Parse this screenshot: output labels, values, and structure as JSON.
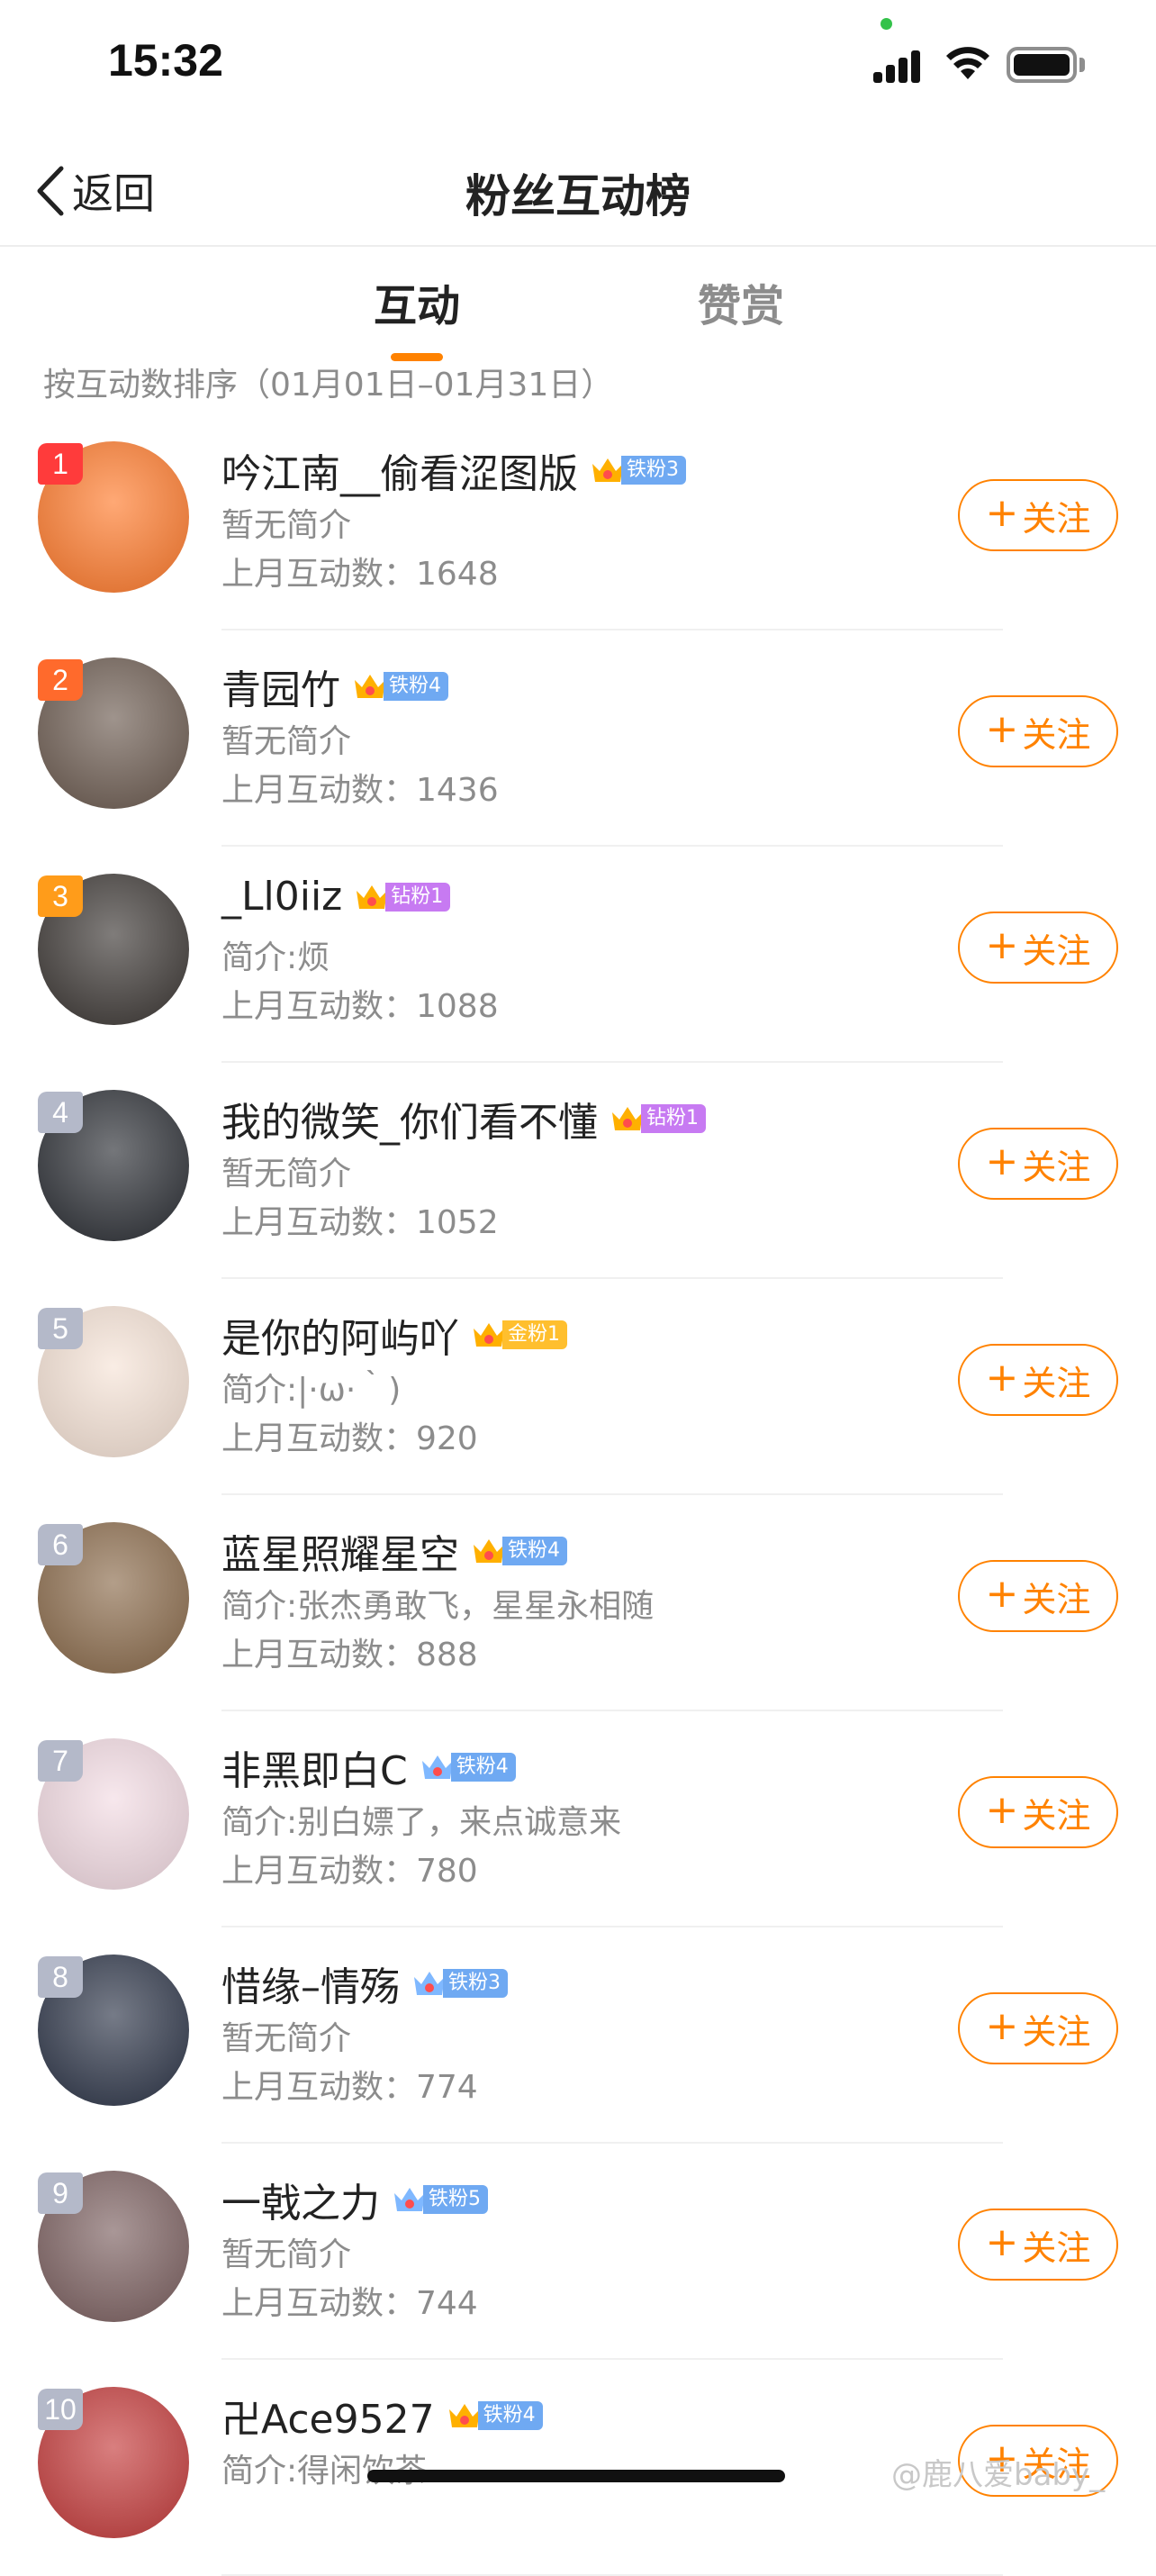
{
  "status_bar": {
    "time": "15:32"
  },
  "nav": {
    "back_label": "返回",
    "title": "粉丝互动榜"
  },
  "tabs": [
    {
      "label": "互动"
    },
    {
      "label": "赞赏"
    }
  ],
  "sort_hint": "按互动数排序（01月01日–01月31日）",
  "follow_label": "关注",
  "fans": [
    {
      "rank": "1",
      "name": "吟江南__偷看涩图版",
      "badge": "铁粉3",
      "badge_color": "#6fa9f2",
      "bio": "暂无简介",
      "count": "上月互动数：1648",
      "avatar_bg": "#ff7a2b",
      "crown_color": "#ffb000"
    },
    {
      "rank": "2",
      "name": "青园竹",
      "badge": "铁粉4",
      "badge_color": "#6fa9f2",
      "bio": "暂无简介",
      "count": "上月互动数：1436",
      "avatar_bg": "#6b5a4f",
      "crown_color": "#ffb000"
    },
    {
      "rank": "3",
      "name": "_Ll0iiz",
      "badge": "钻粉1",
      "badge_color": "#c77af2",
      "bio": "简介:烦",
      "count": "上月互动数：1088",
      "avatar_bg": "#3b3633",
      "crown_color": "#ffb000"
    },
    {
      "rank": "4",
      "name": "我的微笑_你们看不懂",
      "badge": "钻粉1",
      "badge_color": "#c77af2",
      "bio": "暂无简介",
      "count": "上月互动数：1052",
      "avatar_bg": "#2a2d33",
      "crown_color": "#ffb000"
    },
    {
      "rank": "5",
      "name": "是你的阿屿吖",
      "badge": "金粉1",
      "badge_color": "#ffbf2e",
      "bio": "简介:|·ω·｀)",
      "count": "上月互动数：920",
      "avatar_bg": "#f6e3d6",
      "crown_color": "#ffb000"
    },
    {
      "rank": "6",
      "name": "蓝星照耀星空",
      "badge": "铁粉4",
      "badge_color": "#6fa9f2",
      "bio": "简介:张杰勇敢飞，星星永相随",
      "count": "上月互动数：888",
      "avatar_bg": "#8a6a4a",
      "crown_color": "#ffb000"
    },
    {
      "rank": "7",
      "name": "非黑即白C",
      "badge": "铁粉4",
      "badge_color": "#6fa9f2",
      "bio": "简介:别白嫖了，来点诚意来",
      "count": "上月互动数：780",
      "avatar_bg": "#f3dbe3",
      "crown_color": "#7fb8ff"
    },
    {
      "rank": "8",
      "name": "惜缘–情殇",
      "badge": "铁粉3",
      "badge_color": "#6fa9f2",
      "bio": "暂无简介",
      "count": "上月互动数：774",
      "avatar_bg": "#2c3447",
      "crown_color": "#7fb8ff"
    },
    {
      "rank": "9",
      "name": "一戟之力",
      "badge": "铁粉5",
      "badge_color": "#6fa9f2",
      "bio": "暂无简介",
      "count": "上月互动数：744",
      "avatar_bg": "#7b5f5f",
      "crown_color": "#7fb8ff"
    },
    {
      "rank": "10",
      "name": "卍Ace9527",
      "badge": "铁粉4",
      "badge_color": "#6fa9f2",
      "bio": "简介:得闲饮茶",
      "count": "",
      "avatar_bg": "#c43a3a",
      "crown_color": "#ffb000"
    }
  ],
  "watermark": "@鹿八爱baby_"
}
